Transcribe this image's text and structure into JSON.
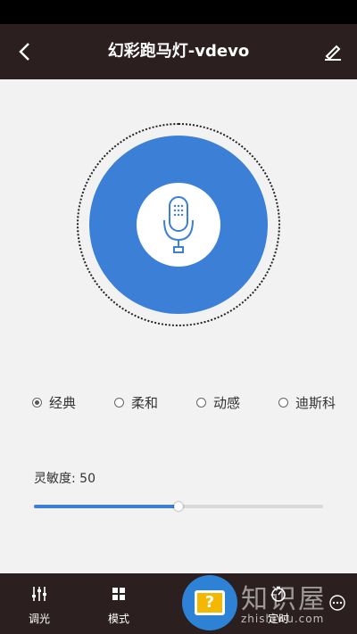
{
  "header": {
    "title": "幻彩跑马灯-vdevo"
  },
  "modes": [
    {
      "label": "经典",
      "checked": true
    },
    {
      "label": "柔和",
      "checked": false
    },
    {
      "label": "动感",
      "checked": false
    },
    {
      "label": "迪斯科",
      "checked": false
    }
  ],
  "sensitivity": {
    "label": "灵敏度: 50",
    "value": 50,
    "max": 100
  },
  "bottom_nav": {
    "items": [
      {
        "label": "调光",
        "icon": "sliders-icon"
      },
      {
        "label": "模式",
        "icon": "grid-icon"
      },
      {
        "label": "定时",
        "icon": "timer-icon"
      },
      {
        "label": "",
        "icon": "more-icon"
      }
    ]
  },
  "watermark": {
    "text": "知识屋",
    "sub": "zhishiwu.com",
    "badge": "?"
  },
  "colors": {
    "accent": "#3c7fd6",
    "header_bg": "#2b1f1f",
    "page_bg": "#f2f2f2"
  }
}
